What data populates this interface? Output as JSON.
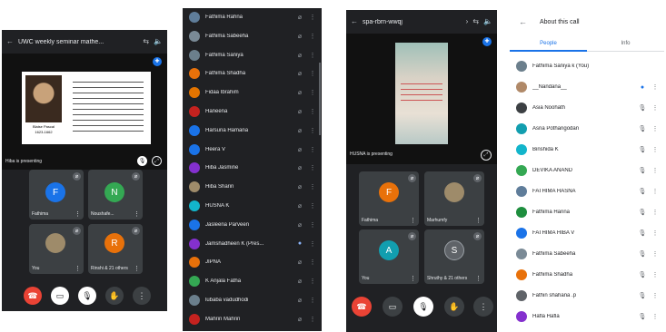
{
  "panel1": {
    "title": "UWC weekly seminar mathe...",
    "slide_text": "Blaise Pascal",
    "slide_years": "1623-1662",
    "presenting": "Hiba is presenting",
    "tiles": [
      {
        "initial": "F",
        "name": "Fathima",
        "color": "#1a73e8"
      },
      {
        "initial": "N",
        "name": "Noushafe...",
        "color": "#34a853"
      },
      {
        "initial": "",
        "name": "You",
        "color": "#9e8b6a"
      },
      {
        "initial": "R",
        "name": "Rinshi & 21 others",
        "color": "#e8710a"
      }
    ],
    "controls": [
      "end-call",
      "caption",
      "mic",
      "hand",
      "more"
    ]
  },
  "panel2": {
    "participants": [
      {
        "name": "Fathima Rahna",
        "color": "#5f7d9a"
      },
      {
        "name": "Fathima Sabeeha",
        "color": "#7a8a96"
      },
      {
        "name": "Fathima Saniya",
        "color": "#6b7f8c"
      },
      {
        "name": "Fathima Shadha",
        "color": "#e8710a"
      },
      {
        "name": "Fidaa Ibrahim",
        "color": "#e37400"
      },
      {
        "name": "Haneena",
        "color": "#c5221f"
      },
      {
        "name": "Harsuna Hamana",
        "color": "#1a73e8"
      },
      {
        "name": "Heera V",
        "color": "#1a73e8"
      },
      {
        "name": "Hiba Jasmine",
        "color": "#8430ce"
      },
      {
        "name": "Hiba Sharin",
        "color": "#9e8b6a"
      },
      {
        "name": "HUSNA K",
        "color": "#12b5cb"
      },
      {
        "name": "Jasleena Parveen",
        "color": "#1a73e8"
      },
      {
        "name": "Jamshadheen K (Pres...",
        "color": "#8430ce"
      },
      {
        "name": "JIPNA",
        "color": "#e8710a"
      },
      {
        "name": "K Anjala Fatha",
        "color": "#34a853"
      },
      {
        "name": "lubaba vadudhodi",
        "color": "#6b7f8c"
      },
      {
        "name": "Mahrin Mahrin",
        "color": "#c5221f"
      }
    ]
  },
  "panel3": {
    "title": "spa-rbrn-wwqj",
    "presenting": "HUSNA is presenting",
    "tiles": [
      {
        "initial": "F",
        "name": "Fathima",
        "color": "#e8710a"
      },
      {
        "initial": "",
        "name": "Marhumfy",
        "color": "#9e8b6a"
      },
      {
        "initial": "A",
        "name": "You",
        "color": "#129eaf"
      },
      {
        "initial": "S",
        "name": "Shruthy & 21 others",
        "color": "#5f6368"
      }
    ]
  },
  "panel4": {
    "title": "About this call",
    "tabs": [
      "People",
      "Info"
    ],
    "people": [
      {
        "name": "Fathima Saniya k (You)",
        "color": "#6b7f8c",
        "mic": "",
        "more": ""
      },
      {
        "name": "__Nandana__",
        "color": "#b08968",
        "mic": "●",
        "more": "⋮"
      },
      {
        "name": "Asia Noohath",
        "color": "#3c4043",
        "mic": "🎙",
        "more": "⋮"
      },
      {
        "name": "Asna Pothangodan",
        "color": "#129eaf",
        "mic": "🎙",
        "more": "⋮"
      },
      {
        "name": "Binshida K",
        "color": "#12b5cb",
        "mic": "🎙",
        "more": "⋮"
      },
      {
        "name": "DEVIKA ANAND",
        "color": "#34a853",
        "mic": "🎙",
        "more": "⋮"
      },
      {
        "name": "FATHIMA HASNA",
        "color": "#5f7d9a",
        "mic": "🎙",
        "more": "⋮"
      },
      {
        "name": "Fathima Hanna",
        "color": "#1e8e3e",
        "mic": "🎙",
        "more": "⋮"
      },
      {
        "name": "FATHIMA HIBA V",
        "color": "#1a73e8",
        "mic": "🎙",
        "more": "⋮"
      },
      {
        "name": "Fathima Sabeeha",
        "color": "#7a8a96",
        "mic": "🎙",
        "more": "⋮"
      },
      {
        "name": "Fathima Shadha",
        "color": "#e8710a",
        "mic": "🎙",
        "more": "⋮"
      },
      {
        "name": "Fathin shahana .p",
        "color": "#5f6368",
        "mic": "🎙",
        "more": "⋮"
      },
      {
        "name": "Hafla Hafla",
        "color": "#8430ce",
        "mic": "🎙",
        "more": "⋮"
      }
    ]
  },
  "colors": {
    "accent": "#1a73e8",
    "end_call": "#ea4335",
    "dark_bg": "#202124",
    "tile_bg": "#3c4043"
  }
}
